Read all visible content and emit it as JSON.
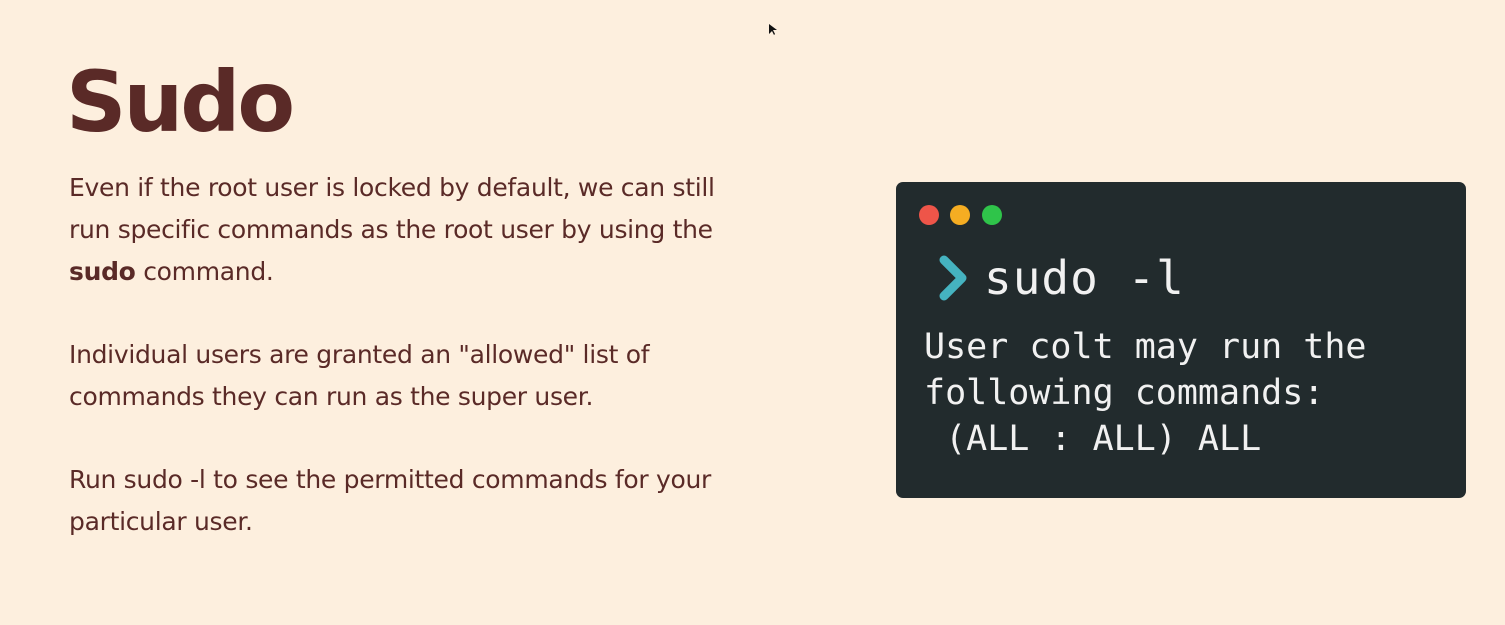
{
  "slide": {
    "title": "Sudo",
    "paragraphs": {
      "p1_before": "Even if the root user is locked by default, we can still run specific commands as the root user by using the ",
      "p1_bold": "sudo",
      "p1_after": " command.",
      "p2": "Individual users are granted an \"allowed\" list of commands they can run as the super user.",
      "p3": "Run sudo -l to see the permitted commands for your particular user."
    }
  },
  "terminal": {
    "window_buttons": [
      "close",
      "minimize",
      "maximize"
    ],
    "prompt_icon": "chevron-right-icon",
    "command": "sudo -l",
    "output_lines": [
      "User colt may run the",
      "following commands:",
      " (ALL : ALL) ALL"
    ]
  },
  "colors": {
    "background": "#fdefde",
    "text": "#5a2a27",
    "terminal_background": "#222b2d",
    "terminal_text": "#f1f1f1",
    "prompt_accent": "#45b3c0",
    "dot_red": "#ee5549",
    "dot_yellow": "#f5ad22",
    "dot_green": "#2fc44a"
  }
}
